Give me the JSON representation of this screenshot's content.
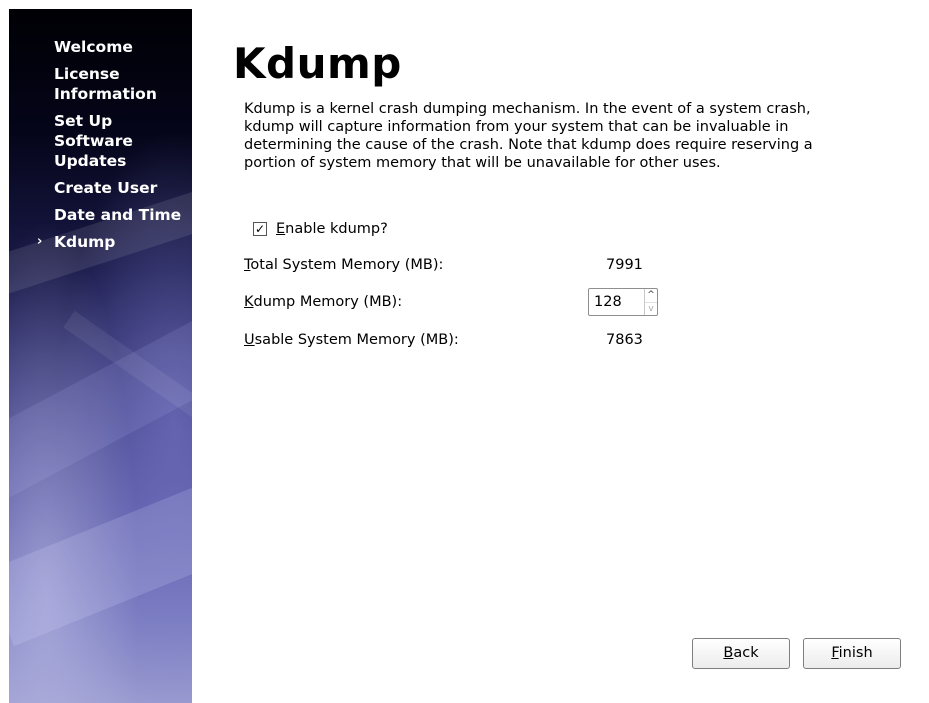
{
  "sidebar": {
    "items": [
      {
        "label": "Welcome"
      },
      {
        "label": "License Information"
      },
      {
        "label": "Set Up Software Updates"
      },
      {
        "label": "Create User"
      },
      {
        "label": "Date and Time"
      },
      {
        "label": "Kdump",
        "active_marker": "›"
      }
    ]
  },
  "page": {
    "title": "Kdump",
    "description": "Kdump is a kernel crash dumping mechanism. In the event of a system crash, kdump will capture information from your system that can be invaluable in determining the cause of the crash. Note that kdump does require reserving a portion of system memory that will be unavailable for other uses."
  },
  "enable": {
    "checked": true,
    "check_glyph": "✓",
    "mnemonic": "E",
    "label_rest": "nable kdump?"
  },
  "memory": {
    "total": {
      "mnemonic": "T",
      "label_rest": "otal System Memory (MB):",
      "value": "7991"
    },
    "kdump": {
      "mnemonic": "K",
      "label_rest": "dump Memory (MB):",
      "value": "128",
      "up_glyph": "^",
      "down_glyph": "v"
    },
    "usable": {
      "mnemonic": "U",
      "label_rest": "sable System Memory (MB):",
      "value": "7863"
    }
  },
  "buttons": {
    "back": {
      "mnemonic": "B",
      "label_rest": "ack"
    },
    "finish": {
      "mnemonic": "F",
      "label_rest": "inish"
    }
  }
}
